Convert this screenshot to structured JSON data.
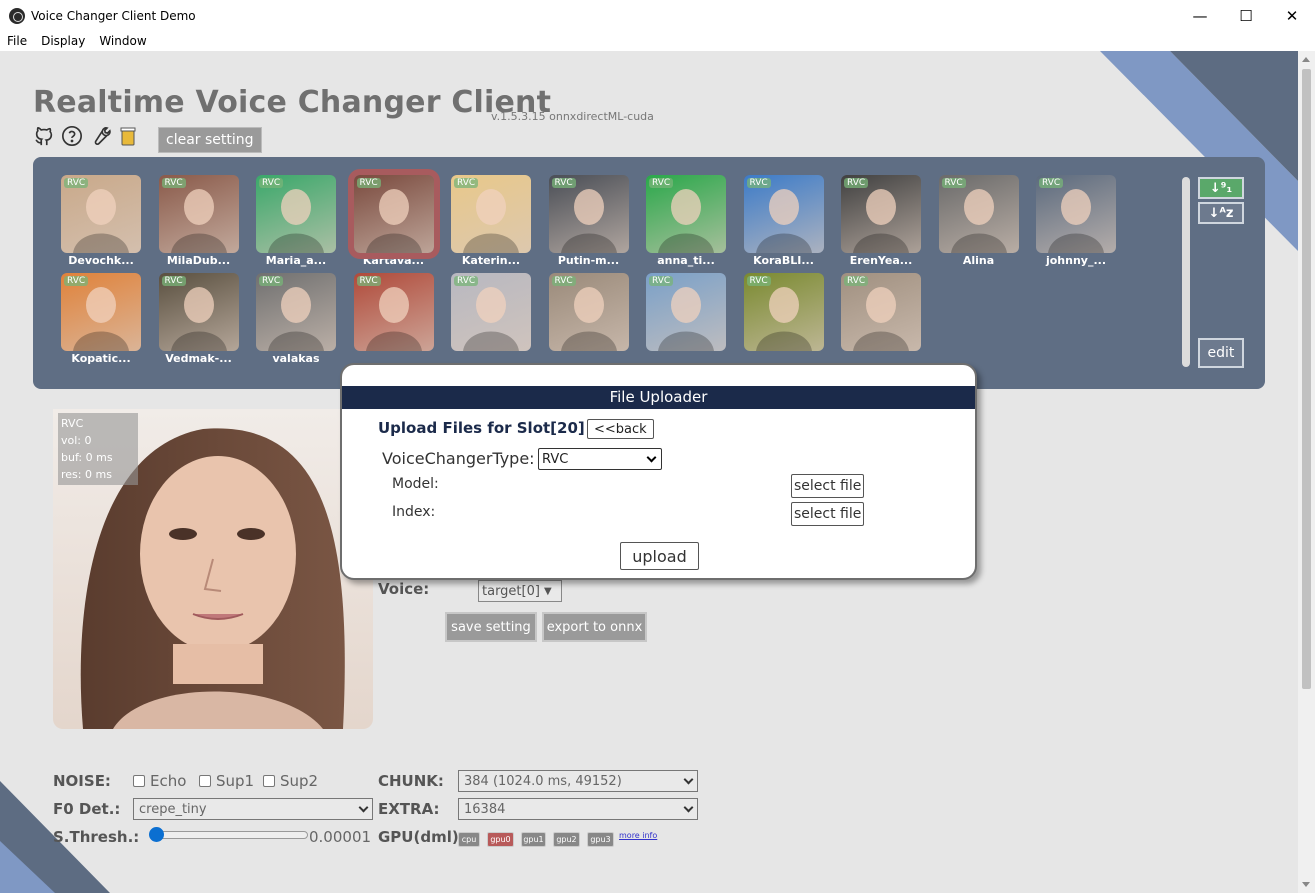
{
  "window": {
    "title": "Voice Changer Client Demo",
    "minimize": "—",
    "maximize": "☐",
    "close": "✕"
  },
  "menu": [
    "File",
    "Display",
    "Window"
  ],
  "header": {
    "title": "Realtime Voice Changer Client",
    "version": "v.1.5.3.15  onnxdirectML-cuda",
    "clear_setting": "clear setting",
    "icons": [
      "github-icon",
      "help-icon",
      "wrench-icon",
      "coffee-icon"
    ]
  },
  "slots": {
    "row1": [
      {
        "tag": "RVC",
        "name": "Devochk...",
        "color": "#c9a98a"
      },
      {
        "tag": "RVC",
        "name": "MilaDub...",
        "color": "#8a5a4a"
      },
      {
        "tag": "RVC",
        "name": "Maria_a...",
        "color": "#3aa86a"
      },
      {
        "tag": "RVC",
        "name": "Kartava...",
        "color": "#7a4a3e"
      },
      {
        "tag": "RVC",
        "name": "Katerin...",
        "color": "#e8c88a"
      },
      {
        "tag": "RVC",
        "name": "Putin-m...",
        "color": "#4a4e56"
      },
      {
        "tag": "RVC",
        "name": "anna_ti...",
        "color": "#2aa84a"
      },
      {
        "tag": "RVC",
        "name": "KoraBLI...",
        "color": "#3c7bc8"
      },
      {
        "tag": "RVC",
        "name": "ErenYea...",
        "color": "#404040"
      },
      {
        "tag": "RVC",
        "name": "Alina",
        "color": "#6a6a6a"
      },
      {
        "tag": "RVC",
        "name": "johnny_...",
        "color": "#5b6a7e"
      }
    ],
    "row2": [
      {
        "tag": "RVC",
        "name": "Kopatic...",
        "color": "#e0823a"
      },
      {
        "tag": "RVC",
        "name": "Vedmak-...",
        "color": "#5a5040"
      },
      {
        "tag": "RVC",
        "name": "valakas",
        "color": "#707070"
      },
      {
        "tag": "RVC",
        "name": "",
        "color": "#b04a3a"
      },
      {
        "tag": "RVC",
        "name": "",
        "color": "#b8b8c0"
      },
      {
        "tag": "RVC",
        "name": "",
        "color": "#9a8a7a"
      },
      {
        "tag": "RVC",
        "name": "",
        "color": "#7aa0c8"
      },
      {
        "tag": "RVC",
        "name": "",
        "color": "#7a8a30"
      },
      {
        "tag": "RVC",
        "name": "",
        "color": "#a09080"
      }
    ],
    "sort_asc": "↓⁹₁",
    "sort_alpha": "↓ᴬᴢ",
    "edit": "edit"
  },
  "preview": {
    "info": [
      "RVC",
      "vol: 0",
      "buf: 0 ms",
      "res: 0 ms"
    ]
  },
  "voice": {
    "label": "Voice:",
    "select_value": "target[0]",
    "save_setting": "save setting",
    "export_onnx": "export to onnx"
  },
  "settings": {
    "noise_label": "NOISE:",
    "echo": "Echo",
    "sup1": "Sup1",
    "sup2": "Sup2",
    "chunk_label": "CHUNK:",
    "chunk_value": "384 (1024.0 ms, 49152)",
    "f0_label": "F0 Det.:",
    "f0_value": "crepe_tiny",
    "extra_label": "EXTRA:",
    "extra_value": "16384",
    "sthresh_label": "S.Thresh.:",
    "sthresh_value": "0.00001",
    "gpu_label": "GPU(dml)",
    "gpu_buttons": [
      "cpu",
      "gpu0",
      "gpu1",
      "gpu2",
      "gpu3"
    ],
    "more_info": "more info"
  },
  "modal": {
    "title": "File Uploader",
    "subtitle": "Upload Files for Slot[20]",
    "back": "<<back",
    "type_label": "VoiceChangerType:",
    "type_value": "RVC",
    "model_label": "Model:",
    "index_label": "Index:",
    "select_file": "select file",
    "upload": "upload"
  },
  "colors": {
    "panel": "#5f6e84",
    "modal_header": "#1b2a4a",
    "accent_blue": "#0b6fd1",
    "deco_blue": "#7f98c4"
  }
}
